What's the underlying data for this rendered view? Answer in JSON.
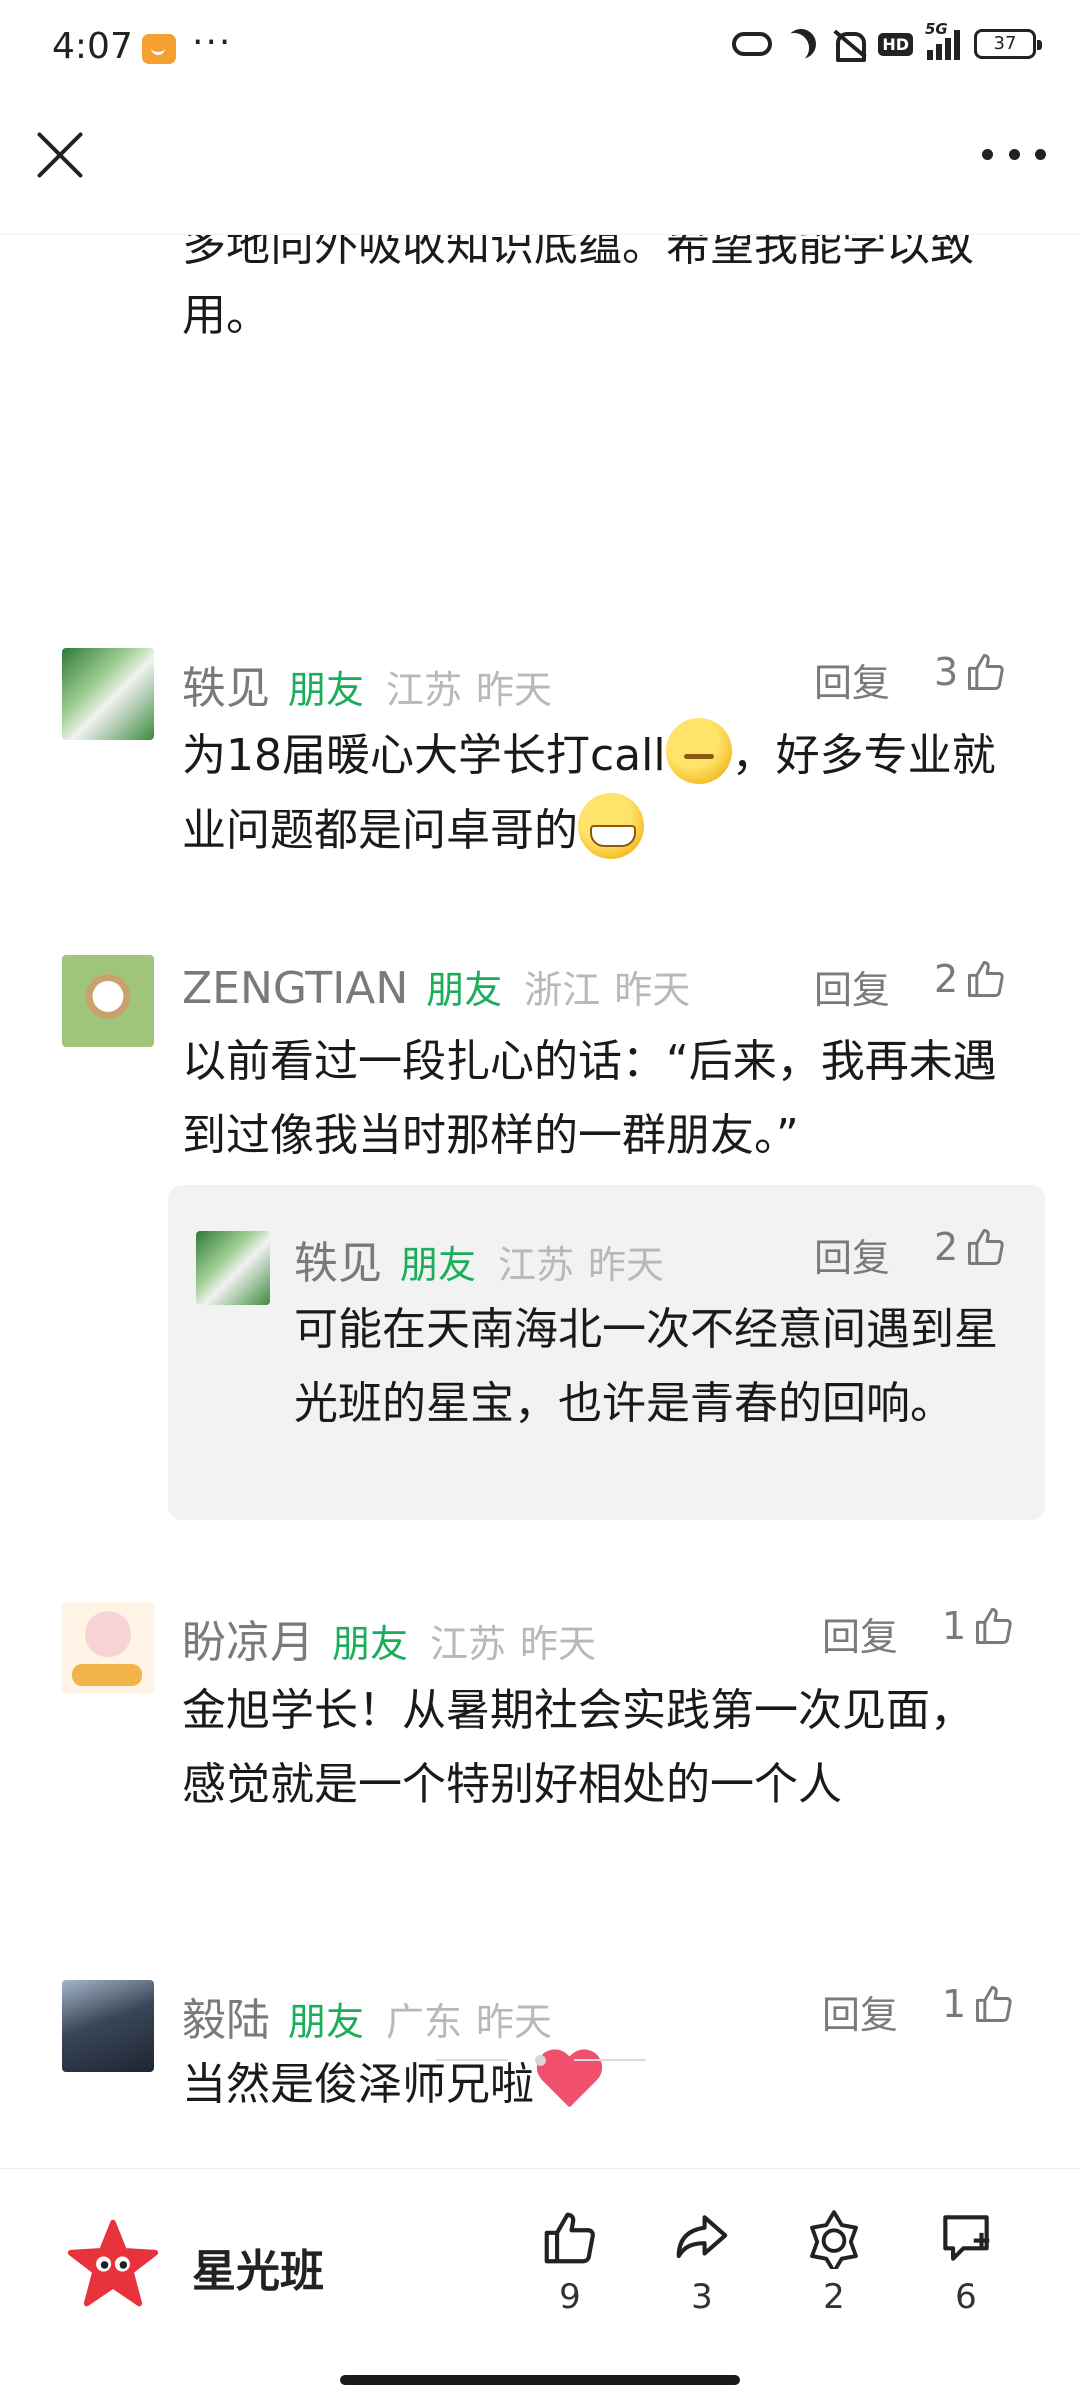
{
  "status_bar": {
    "time": "4:07",
    "dots": "···",
    "network": "5G",
    "hd": "HD",
    "battery": "37"
  },
  "top_text": "多地向外吸收知识底蕴。希望我能学以致用。",
  "reply_label": "回复",
  "comments": [
    {
      "user": "轶见",
      "badge": "朋友",
      "location": "江苏",
      "time": "昨天",
      "likes": "3",
      "text_before": "为18届暖心大学长打call",
      "text_middle": "，好多专业就业问题都是问卓哥的",
      "text_after": ""
    },
    {
      "user": "ZENGTIAN",
      "badge": "朋友",
      "location": "浙江",
      "time": "昨天",
      "likes": "2",
      "text": "以前看过一段扎心的话：“后来，我再未遇到过像我当时那样的一群朋友。”",
      "reply": {
        "user": "轶见",
        "badge": "朋友",
        "location": "江苏",
        "time": "昨天",
        "likes": "2",
        "text": "可能在天南海北一次不经意间遇到星光班的星宝，也许是青春的回响。"
      }
    },
    {
      "user": "盼凉月",
      "badge": "朋友",
      "location": "江苏",
      "time": "昨天",
      "likes": "1",
      "text": "金旭学长！从暑期社会实践第一次见面，感觉就是一个特别好相处的一个人"
    },
    {
      "user": "毅陆",
      "badge": "朋友",
      "location": "广东",
      "time": "昨天",
      "likes": "1",
      "text": "当然是俊泽师兄啦"
    }
  ],
  "bottom_bar": {
    "account_name": "星光班",
    "actions": [
      {
        "name": "like",
        "icon": "thumbs-up-icon",
        "count": "9"
      },
      {
        "name": "share",
        "icon": "share-arrow-icon",
        "count": "3"
      },
      {
        "name": "recommend",
        "icon": "star-flower-icon",
        "count": "2"
      },
      {
        "name": "comment",
        "icon": "comment-add-icon",
        "count": "6"
      }
    ]
  },
  "colors": {
    "friend_badge": "#1aad5a",
    "meta_gray": "#b8b8b8",
    "reply_bg": "#f2f2f2",
    "logo_red": "#e8323c"
  }
}
